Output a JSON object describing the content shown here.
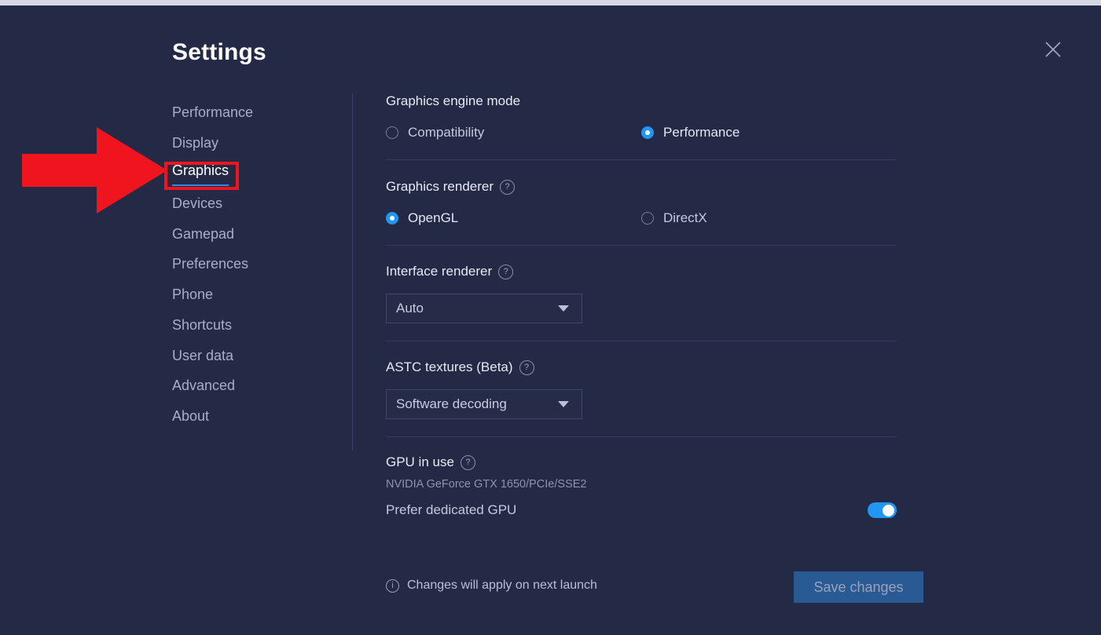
{
  "window": {
    "background_color": "#242a45",
    "accent_color": "#2196f3",
    "annotation_color": "#f0141e"
  },
  "header": {
    "title": "Settings",
    "close_icon": "close-icon"
  },
  "sidebar": {
    "items": [
      {
        "label": "Performance",
        "active": false
      },
      {
        "label": "Display",
        "active": false
      },
      {
        "label": "Graphics",
        "active": true
      },
      {
        "label": "Devices",
        "active": false
      },
      {
        "label": "Gamepad",
        "active": false
      },
      {
        "label": "Preferences",
        "active": false
      },
      {
        "label": "Phone",
        "active": false
      },
      {
        "label": "Shortcuts",
        "active": false
      },
      {
        "label": "User data",
        "active": false
      },
      {
        "label": "Advanced",
        "active": false
      },
      {
        "label": "About",
        "active": false
      }
    ]
  },
  "main": {
    "sections": {
      "engine_mode": {
        "title": "Graphics engine mode",
        "options": [
          {
            "label": "Compatibility",
            "selected": false
          },
          {
            "label": "Performance",
            "selected": true
          }
        ]
      },
      "graphics_renderer": {
        "title": "Graphics renderer",
        "help_icon": "help-circle-icon",
        "options": [
          {
            "label": "OpenGL",
            "selected": true
          },
          {
            "label": "DirectX",
            "selected": false
          }
        ]
      },
      "interface_renderer": {
        "title": "Interface renderer",
        "help_icon": "help-circle-icon",
        "selected_value": "Auto",
        "caret_icon": "chevron-down-icon"
      },
      "astc_textures": {
        "title": "ASTC textures (Beta)",
        "help_icon": "help-circle-icon",
        "selected_value": "Software decoding",
        "caret_icon": "chevron-down-icon"
      },
      "gpu_in_use": {
        "title": "GPU in use",
        "help_icon": "help-circle-icon",
        "gpu_name": "NVIDIA GeForce GTX 1650/PCIe/SSE2",
        "toggle_label": "Prefer dedicated GPU",
        "toggle_on": true
      }
    }
  },
  "footer": {
    "info_icon": "info-circle-icon",
    "note": "Changes will apply on next launch",
    "save_label": "Save changes"
  },
  "annotation": {
    "arrow_icon": "right-arrow-annotation",
    "highlight_target": "Graphics"
  }
}
